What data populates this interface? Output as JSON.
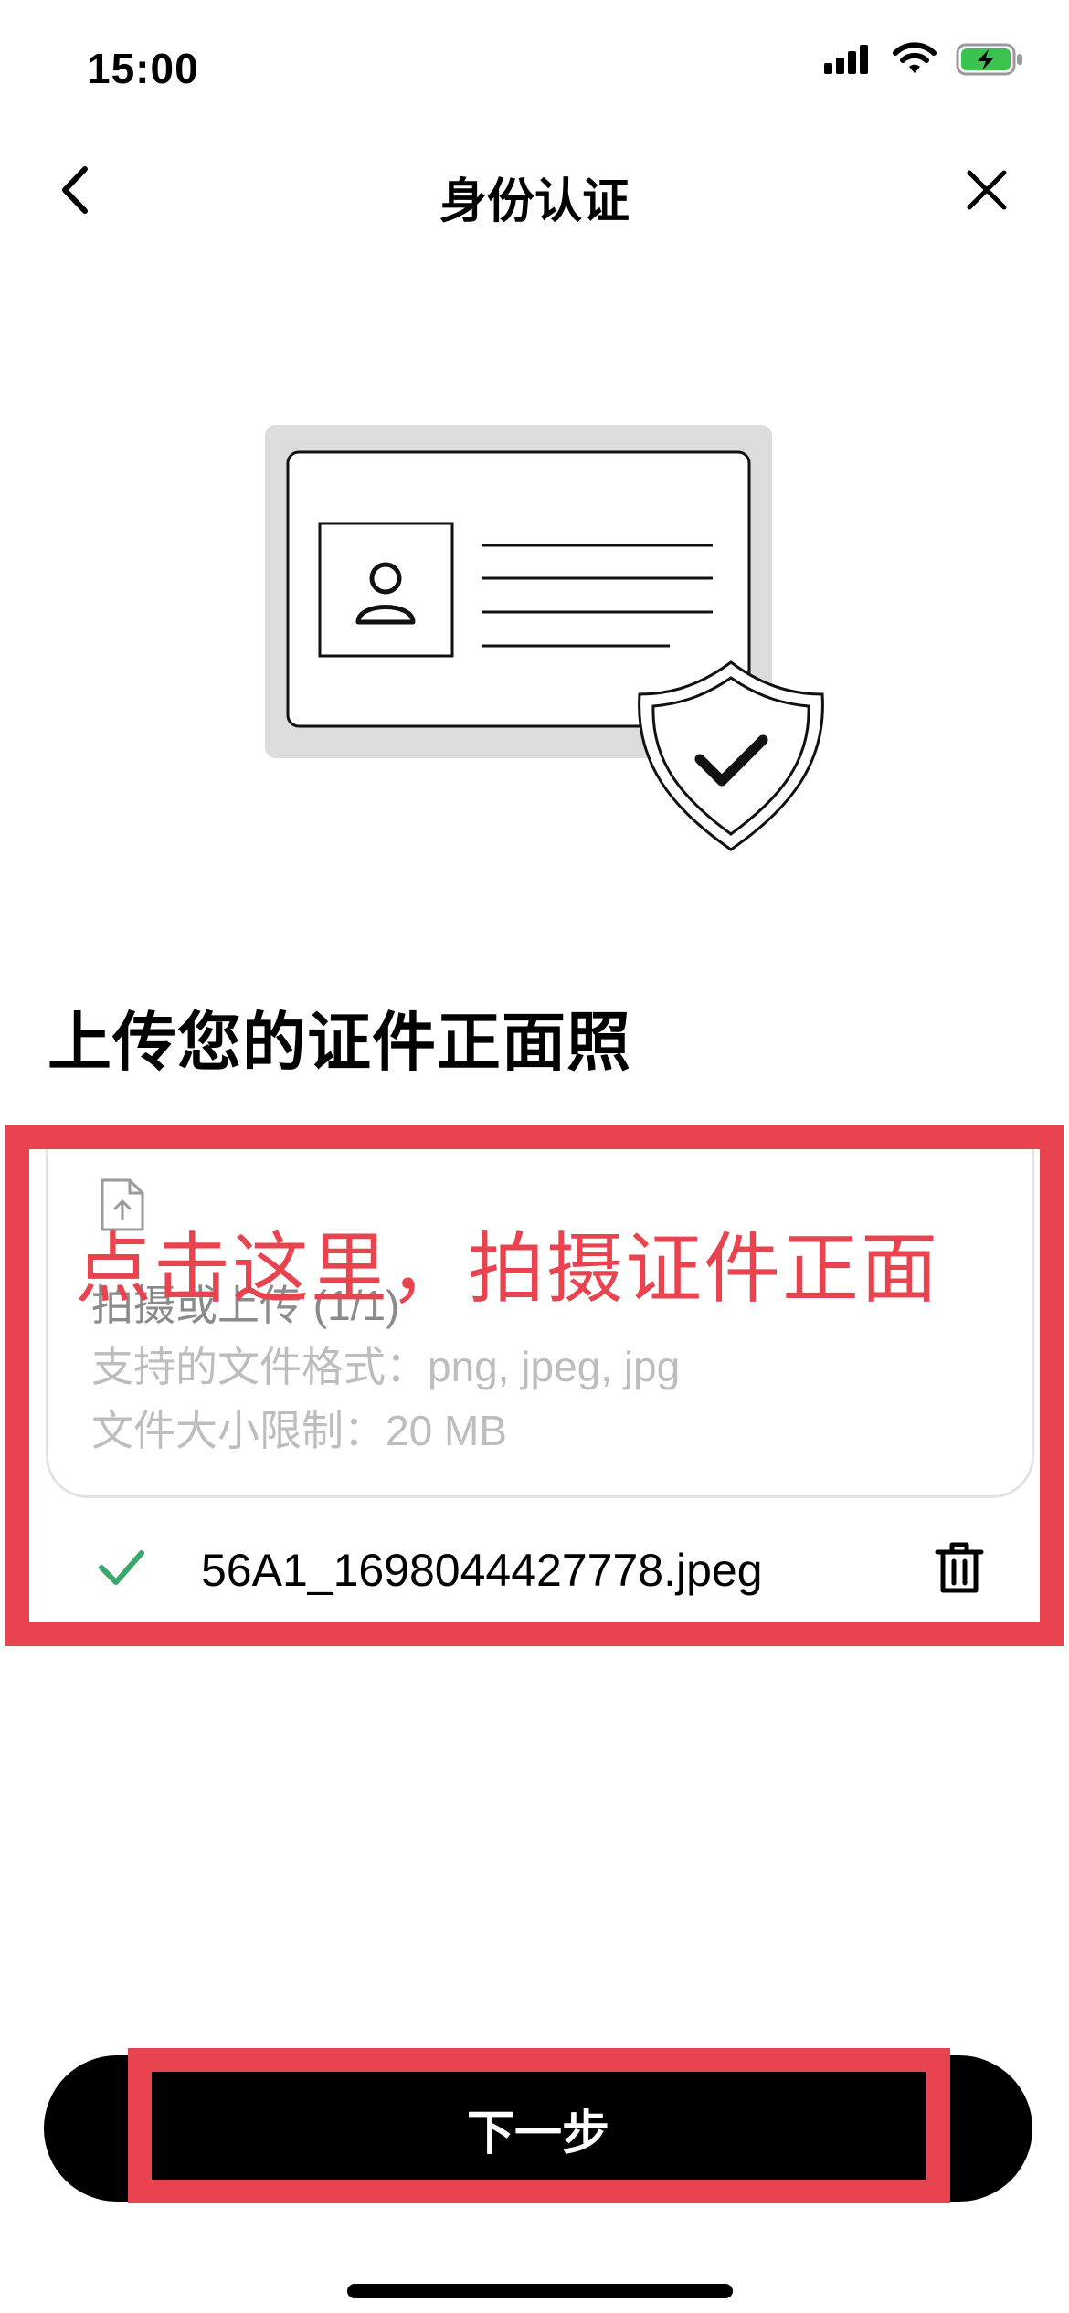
{
  "status_bar": {
    "time": "15:00"
  },
  "nav": {
    "title": "身份认证"
  },
  "upload": {
    "section_title": "上传您的证件正面照",
    "label": "拍摄或上传 (1/1)",
    "format_hint": "支持的文件格式：png, jpeg, jpg",
    "size_hint": "文件大小限制：20 MB"
  },
  "uploaded_file": {
    "name": "56A1_1698044427778.jpeg"
  },
  "annotation": {
    "text": "点击这里，拍摄证件正面"
  },
  "footer": {
    "next_label": "下一步"
  },
  "colors": {
    "accent": "#e8434f",
    "success": "#3aa76d",
    "button": "#000000"
  }
}
